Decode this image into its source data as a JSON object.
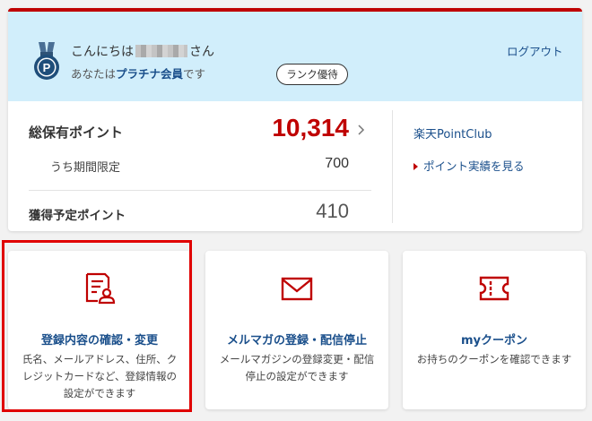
{
  "header": {
    "greeting_prefix": "こんにちは",
    "greeting_suffix": "さん",
    "member_prefix": "あなたは",
    "member_rank": "プラチナ会員",
    "member_suffix": "です",
    "rank_button": "ランク優待",
    "logout": "ログアウト",
    "badge_letter": "P"
  },
  "points": {
    "total_label": "総保有ポイント",
    "total_value": "10,314",
    "limited_label": "うち期間限定",
    "limited_value": "700",
    "pending_label": "獲得予定ポイント",
    "pending_value": "410",
    "club_link": "楽天PointClub",
    "history_link": "ポイント実績を見る"
  },
  "tiles": [
    {
      "title": "登録内容の確認・変更",
      "desc": "氏名、メールアドレス、住所、クレジットカードなど、登録情報の設定ができます",
      "icon": "profile-document-icon"
    },
    {
      "title": "メルマガの登録・配信停止",
      "desc": "メールマガジンの登録変更・配信停止の設定ができます",
      "icon": "mail-icon"
    },
    {
      "title": "myクーポン",
      "desc": "お持ちのクーポンを確認できます",
      "icon": "coupon-ticket-icon"
    }
  ],
  "colors": {
    "brand_red": "#bf0000",
    "link_blue": "#1a4f8b",
    "header_bg": "#d1eefb",
    "highlight": "#e00000"
  }
}
